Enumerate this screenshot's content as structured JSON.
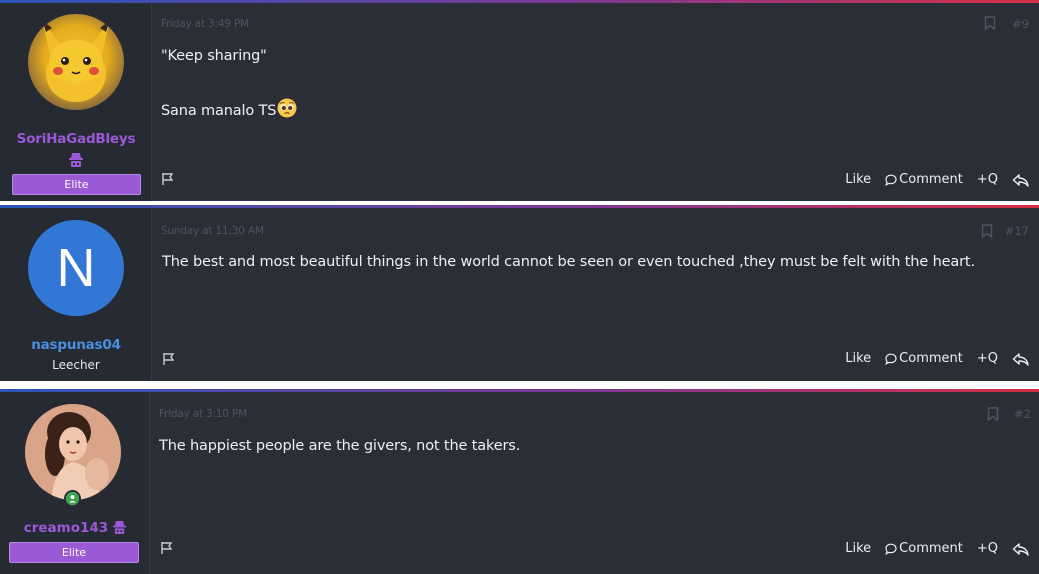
{
  "posts": [
    {
      "date": "Friday at 3:49 PM",
      "number": "#9",
      "username": "SoriHaGadBleys",
      "username_color": "#9b59d6",
      "avatar": "pikachu-avatar",
      "rank": "Elite",
      "lines": [
        "\"Keep sharing\"",
        "Sana manalo TS"
      ],
      "emoji": "pleading-face-emoji",
      "actions": {
        "like": "Like",
        "comment": "Comment",
        "quote": "+Q"
      }
    },
    {
      "date": "Sunday at 11:30 AM",
      "number": "#17",
      "username": "naspunas04",
      "username_color": "#4a8ee0",
      "avatar_letter": "N",
      "avatar_color": "#3377d6",
      "rank": "Leecher",
      "lines": [
        "The best and most beautiful things in the world cannot be seen or even touched ,they must be felt with the heart."
      ],
      "actions": {
        "like": "Like",
        "comment": "Comment",
        "quote": "+Q"
      }
    },
    {
      "date": "Friday at 3:10 PM",
      "number": "#2",
      "username": "creamo143",
      "username_color": "#9b59d6",
      "avatar": "woman-photo-avatar",
      "rank": "Elite",
      "lines": [
        "The happiest people are the givers, not the takers."
      ],
      "actions": {
        "like": "Like",
        "comment": "Comment",
        "quote": "+Q"
      }
    }
  ],
  "colors": {
    "accent": "#9b59d6",
    "background": "#2b2e37",
    "userpane": "#262a33"
  }
}
